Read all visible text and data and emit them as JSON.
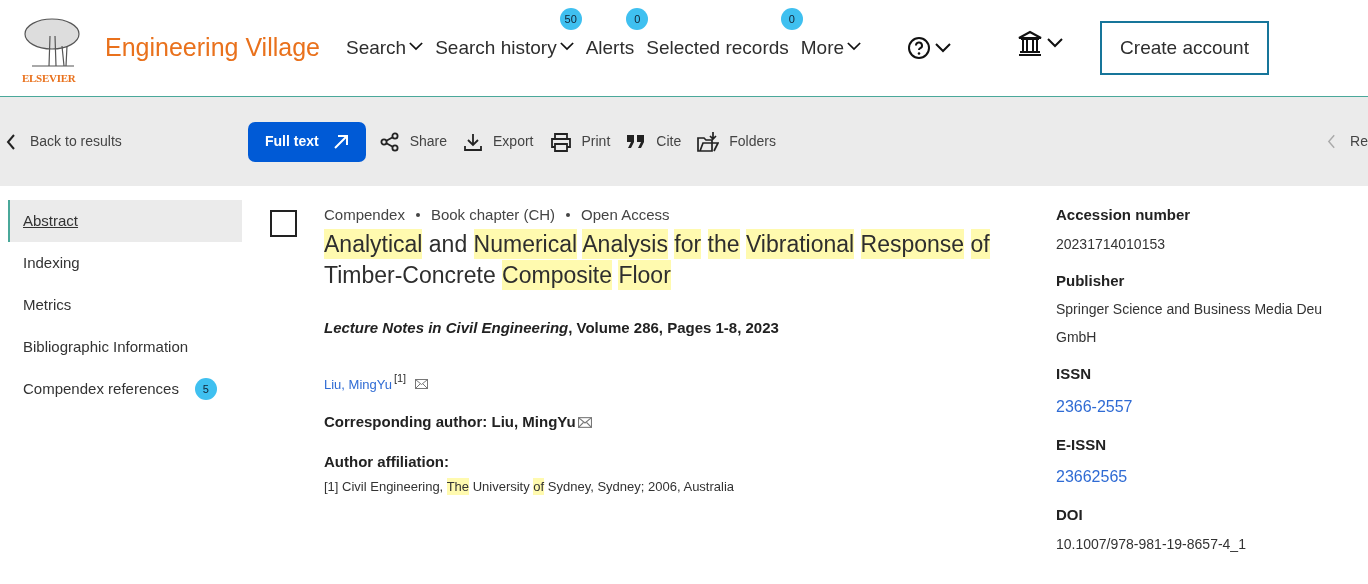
{
  "header": {
    "brand": "Engineering Village",
    "logo_text": "ELSEVIER",
    "nav": [
      {
        "label": "Search",
        "dropdown": true
      },
      {
        "label": "Search history",
        "dropdown": true,
        "badge": "50"
      },
      {
        "label": "Alerts",
        "dropdown": false,
        "badge": "0"
      },
      {
        "label": "Selected records",
        "dropdown": false,
        "badge": "0"
      },
      {
        "label": "More",
        "dropdown": true
      }
    ],
    "create_account": "Create account"
  },
  "toolbar": {
    "back": "Back to results",
    "full_text": "Full text",
    "actions": [
      {
        "kind": "share",
        "label": "Share"
      },
      {
        "kind": "export",
        "label": "Export"
      },
      {
        "kind": "print",
        "label": "Print"
      },
      {
        "kind": "cite",
        "label": "Cite"
      },
      {
        "kind": "folders",
        "label": "Folders"
      }
    ],
    "next": "Re"
  },
  "sidebar": {
    "items": [
      {
        "label": "Abstract",
        "selected": true
      },
      {
        "label": "Indexing",
        "selected": false
      },
      {
        "label": "Metrics",
        "selected": false
      },
      {
        "label": "Bibliographic Information",
        "selected": false
      },
      {
        "label": "Compendex references",
        "selected": false,
        "badge": "5"
      }
    ]
  },
  "record": {
    "checked": false,
    "meta": [
      "Compendex",
      "Book chapter (CH)",
      "Open Access"
    ],
    "title": [
      {
        "text": "Analytical",
        "highlighted": true
      },
      {
        "text": "and",
        "highlighted": false
      },
      {
        "text": "Numerical",
        "highlighted": true
      },
      {
        "text": "Analysis",
        "highlighted": true
      },
      {
        "text": "for",
        "highlighted": true
      },
      {
        "text": "the",
        "highlighted": true
      },
      {
        "text": "Vibrational",
        "highlighted": true
      },
      {
        "text": "Response",
        "highlighted": true
      },
      {
        "text": "of",
        "highlighted": true
      },
      {
        "text": "Timber-Concrete",
        "highlighted": false
      },
      {
        "text": "Composite",
        "highlighted": true
      },
      {
        "text": "Floor",
        "highlighted": true
      }
    ],
    "citation": "*Lecture Notes in Civil Engineering*, Volume 286, Pages 1-8, 2023",
    "author": {
      "name": "Liu, MingYu",
      "affiliation_ref": "[1]"
    },
    "corresponding_author": "Corresponding author: Liu, MingYu",
    "affiliation_label": "Author affiliation:",
    "affiliation": [
      {
        "text": "[1] Civil Engineering,",
        "highlighted": false
      },
      {
        "text": "The",
        "highlighted": true
      },
      {
        "text": "University",
        "highlighted": false
      },
      {
        "text": "of",
        "highlighted": true
      },
      {
        "text": "Sydney, Sydney; 2006, Australia",
        "highlighted": false
      }
    ]
  },
  "details": [
    {
      "label": "Accession number",
      "lines": [
        "20231714010153"
      ],
      "link": false
    },
    {
      "label": "Publisher",
      "lines": [
        "Springer Science and Business Media Deu",
        "GmbH"
      ],
      "link": false
    },
    {
      "label": "ISSN",
      "lines": [
        "2366-2557"
      ],
      "link": true
    },
    {
      "label": "E-ISSN",
      "lines": [
        "23662565"
      ],
      "link": true
    },
    {
      "label": "DOI",
      "lines": [
        "10.1007/978-981-19-8657-4_1"
      ],
      "link": false
    }
  ]
}
